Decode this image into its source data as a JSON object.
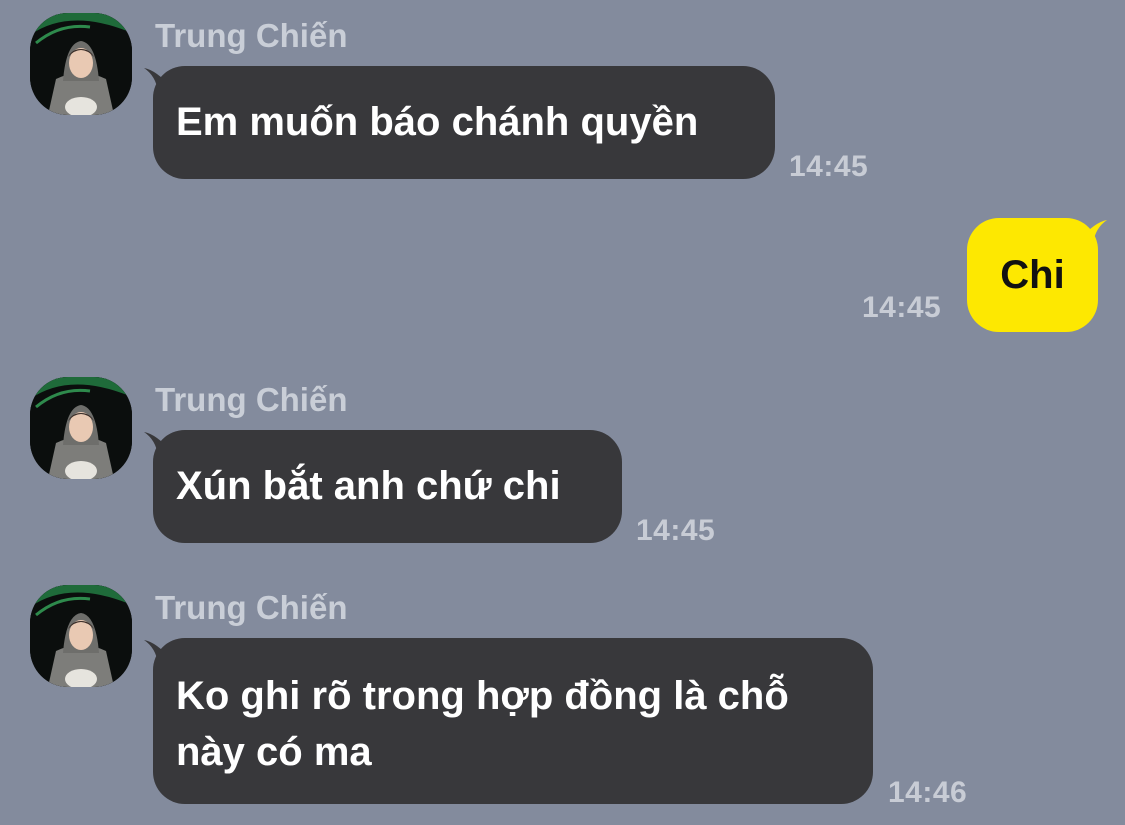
{
  "messages": [
    {
      "direction": "in",
      "sender": "Trung Chiến",
      "avatar_icon": "user-avatar-photo",
      "lines": [
        "Em muốn báo chánh quyền"
      ],
      "time": "14:45"
    },
    {
      "direction": "out",
      "lines": [
        "Chi"
      ],
      "time": "14:45"
    },
    {
      "direction": "in",
      "sender": "Trung Chiến",
      "avatar_icon": "user-avatar-photo",
      "lines": [
        "Xún bắt anh chứ chi"
      ],
      "time": "14:45"
    },
    {
      "direction": "in",
      "sender": "Trung Chiến",
      "avatar_icon": "user-avatar-photo",
      "lines": [
        "Ko ghi rõ trong hợp đồng là chỗ",
        "này có ma"
      ],
      "time": "14:46"
    }
  ],
  "colors": {
    "background": "#838b9d",
    "incoming_bubble": "#38383b",
    "outgoing_bubble": "#fde801",
    "timestamp": "#c8ccd5",
    "sender_name": "#c9ced7"
  }
}
